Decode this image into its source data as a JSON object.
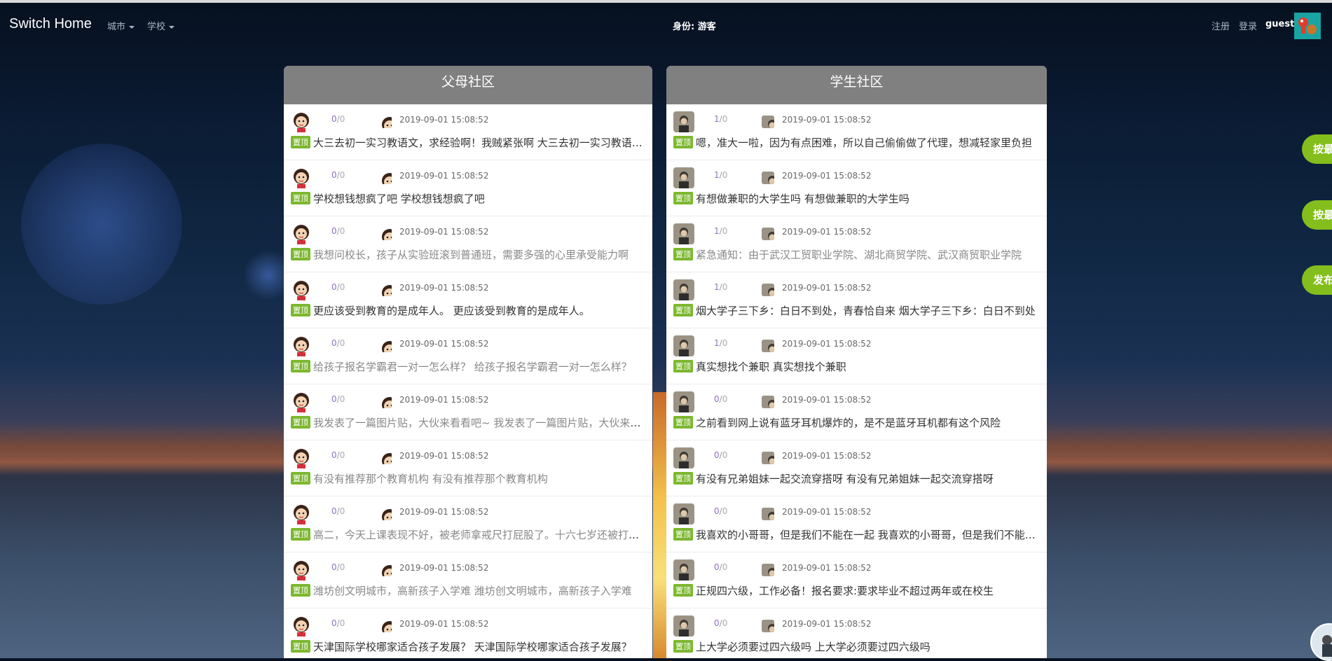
{
  "nav": {
    "brand": "Switch Home",
    "city_menu": "城市",
    "school_menu": "学校",
    "identity": "身份: 游客",
    "register": "注册",
    "login": "登录",
    "username": "guest"
  },
  "panels": {
    "parents": {
      "title": "父母社区",
      "posts": [
        {
          "c1": "0",
          "c2": "0",
          "time": "2019-09-01 15:08:52",
          "tag": "置顶",
          "title": "大三去初一实习教语文，求经验啊！我贼紧张啊 大三去初一实习教语文，求经验啊！我贼紧张啊"
        },
        {
          "c1": "0",
          "c2": "0",
          "time": "2019-09-01 15:08:52",
          "tag": "置顶",
          "title": "学校想钱想疯了吧 学校想钱想疯了吧"
        },
        {
          "c1": "0",
          "c2": "0",
          "time": "2019-09-01 15:08:52",
          "tag": "置顶",
          "title": "我想问校长，孩子从实验班滚到普通班，需要多强的心里承受能力啊"
        },
        {
          "c1": "0",
          "c2": "0",
          "time": "2019-09-01 15:08:52",
          "tag": "置顶",
          "title": "更应该受到教育的是成年人。 更应该受到教育的是成年人。"
        },
        {
          "c1": "0",
          "c2": "0",
          "time": "2019-09-01 15:08:52",
          "tag": "置顶",
          "title": "给孩子报名学霸君一对一怎么样？ 给孩子报名学霸君一对一怎么样？"
        },
        {
          "c1": "0",
          "c2": "0",
          "time": "2019-09-01 15:08:52",
          "tag": "置顶",
          "title": "我发表了一篇图片贴，大伙来看看吧~ 我发表了一篇图片贴，大伙来看看吧~"
        },
        {
          "c1": "0",
          "c2": "0",
          "time": "2019-09-01 15:08:52",
          "tag": "置顶",
          "title": "有没有推荐那个教育机构 有没有推荐那个教育机构"
        },
        {
          "c1": "0",
          "c2": "0",
          "time": "2019-09-01 15:08:52",
          "tag": "置顶",
          "title": "高二，今天上课表现不好，被老师拿戒尺打屁股了。十六七岁还被打屁股"
        },
        {
          "c1": "0",
          "c2": "0",
          "time": "2019-09-01 15:08:52",
          "tag": "置顶",
          "title": "潍坊创文明城市，高新孩子入学难 潍坊创文明城市，高新孩子入学难"
        },
        {
          "c1": "0",
          "c2": "0",
          "time": "2019-09-01 15:08:52",
          "tag": "置顶",
          "title": "天津国际学校哪家适合孩子发展？ 天津国际学校哪家适合孩子发展？"
        }
      ]
    },
    "students": {
      "title": "学生社区",
      "posts": [
        {
          "c1": "1",
          "c2": "0",
          "time": "2019-09-01 15:08:52",
          "tag": "置顶",
          "title": "嗯，准大一啦，因为有点困难，所以自己偷偷做了代理，想减轻家里负担"
        },
        {
          "c1": "1",
          "c2": "0",
          "time": "2019-09-01 15:08:52",
          "tag": "置顶",
          "title": "有想做兼职的大学生吗 有想做兼职的大学生吗"
        },
        {
          "c1": "1",
          "c2": "0",
          "time": "2019-09-01 15:08:52",
          "tag": "置顶",
          "title": "紧急通知：由于武汉工贸职业学院、湖北商贸学院、武汉商贸职业学院"
        },
        {
          "c1": "1",
          "c2": "0",
          "time": "2019-09-01 15:08:52",
          "tag": "置顶",
          "title": "烟大学子三下乡：白日不到处，青春恰自来 烟大学子三下乡：白日不到处"
        },
        {
          "c1": "1",
          "c2": "0",
          "time": "2019-09-01 15:08:52",
          "tag": "置顶",
          "title": "真实想找个兼职 真实想找个兼职"
        },
        {
          "c1": "0",
          "c2": "0",
          "time": "2019-09-01 15:08:52",
          "tag": "置顶",
          "title": "之前看到网上说有蓝牙耳机爆炸的，是不是蓝牙耳机都有这个风险"
        },
        {
          "c1": "0",
          "c2": "0",
          "time": "2019-09-01 15:08:52",
          "tag": "置顶",
          "title": "有没有兄弟姐妹一起交流穿搭呀 有没有兄弟姐妹一起交流穿搭呀"
        },
        {
          "c1": "0",
          "c2": "0",
          "time": "2019-09-01 15:08:52",
          "tag": "置顶",
          "title": "我喜欢的小哥哥，但是我们不能在一起 我喜欢的小哥哥，但是我们不能在一起"
        },
        {
          "c1": "0",
          "c2": "0",
          "time": "2019-09-01 15:08:52",
          "tag": "置顶",
          "title": "正规四六级，工作必备！报名要求:要求毕业不超过两年或在校生"
        },
        {
          "c1": "0",
          "c2": "0",
          "time": "2019-09-01 15:08:52",
          "tag": "置顶",
          "title": "上大学必须要过四六级吗 上大学必须要过四六级吗"
        }
      ]
    }
  },
  "float_buttons": [
    "按最",
    "按最",
    "发布"
  ]
}
